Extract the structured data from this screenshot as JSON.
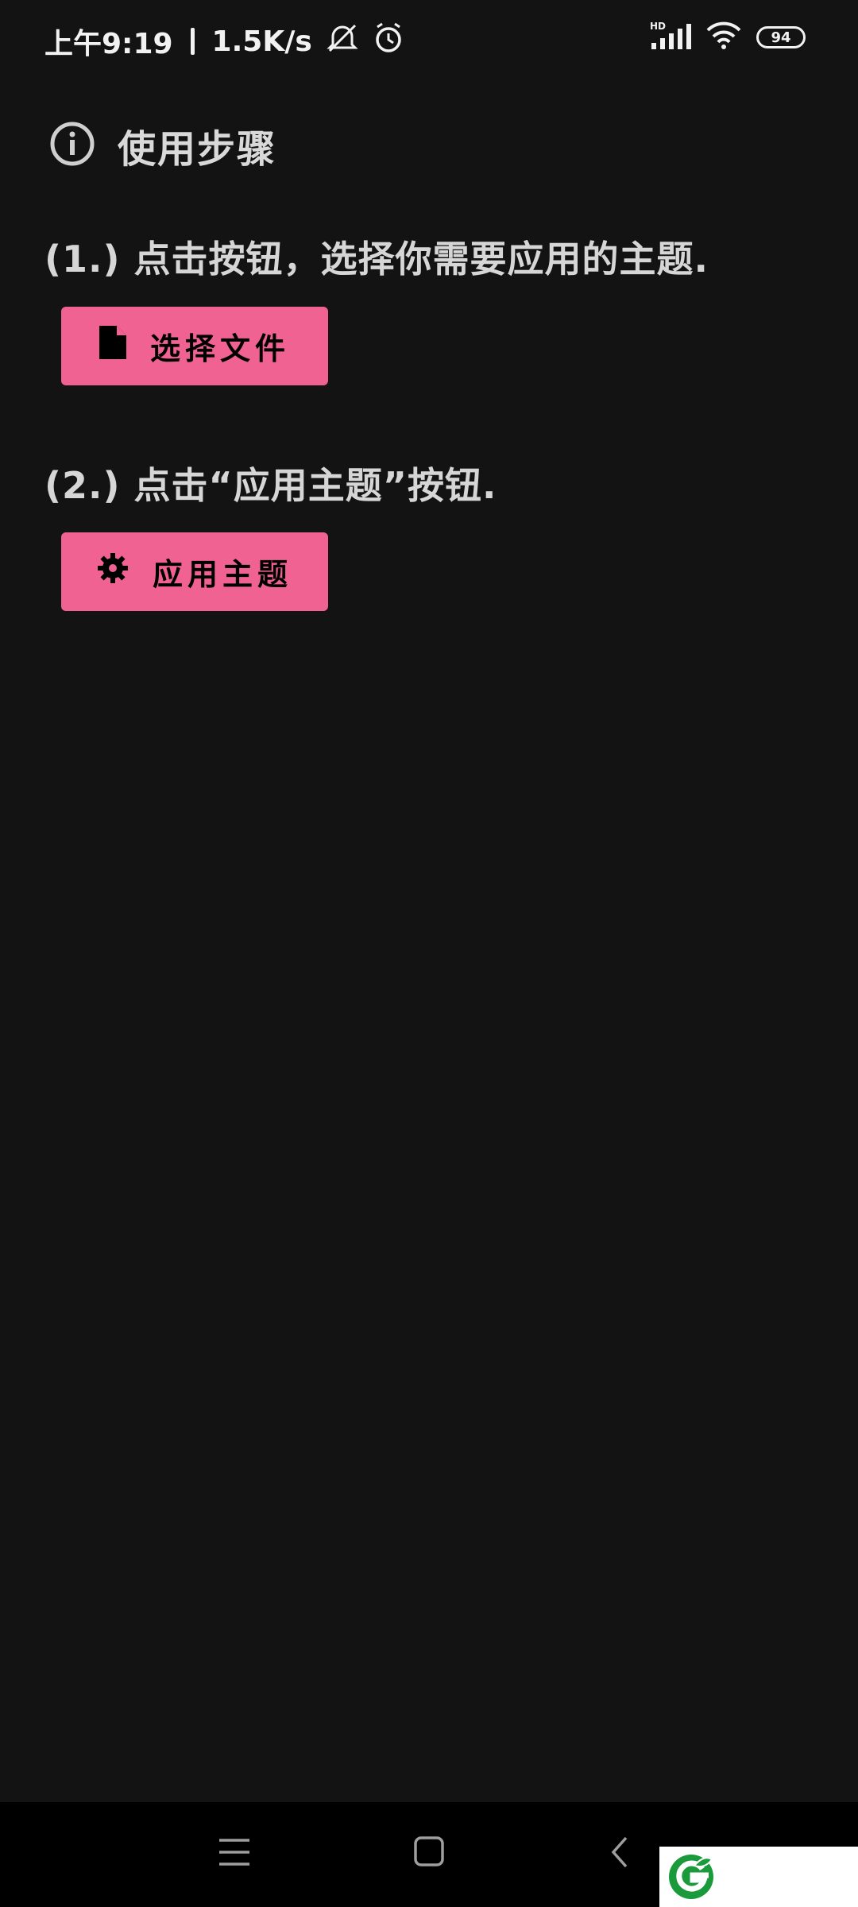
{
  "status_bar": {
    "time": "上午9:19",
    "speed": "1.5K/s",
    "network_label": "HD",
    "battery": "94"
  },
  "header": {
    "title": "使用步骤"
  },
  "steps": [
    {
      "text": "(1.) 点击按钮，选择你需要应用的主题.",
      "button_label": "选择文件"
    },
    {
      "text": "(2.) 点击“应用主题”按钮.",
      "button_label": "应用主题"
    }
  ],
  "colors": {
    "background": "#131313",
    "accent": "#f06292",
    "text": "#d6d6d6"
  },
  "icons": {
    "header": "info-icon",
    "step1_button": "file-icon",
    "step2_button": "gear-icon"
  }
}
